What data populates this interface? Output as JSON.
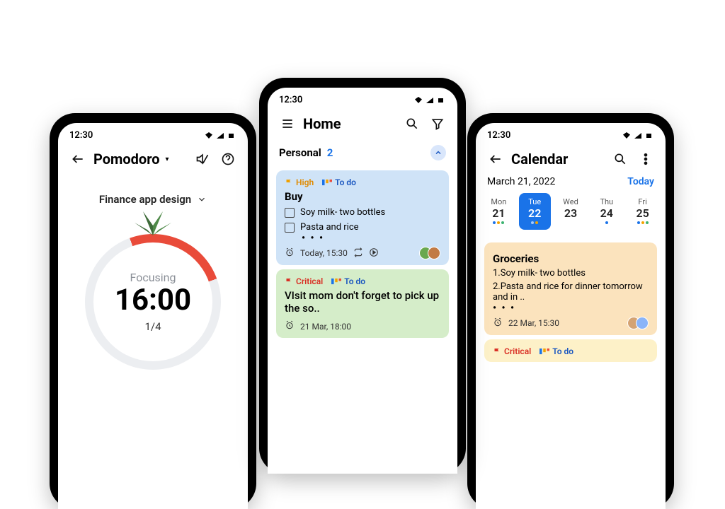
{
  "statusbar": {
    "time": "12:30"
  },
  "pomodoro": {
    "title": "Pomodoro",
    "task": "Finance app design",
    "status": "Focusing",
    "time": "16:00",
    "cycle": "1/4"
  },
  "home": {
    "title": "Home",
    "section": {
      "name": "Personal",
      "count": "2"
    },
    "card1": {
      "priority": "High",
      "kanban": "To do",
      "title": "Buy",
      "item1": "Soy milk- two bottles",
      "item2": "Pasta and rice",
      "more": "• • •",
      "due": "Today, 15:30"
    },
    "card2": {
      "priority": "Critical",
      "kanban": "To do",
      "title": "VIsit mom don't forget to pick up the so..",
      "due": "21 Mar, 18:00"
    }
  },
  "calendar": {
    "title": "Calendar",
    "date": "March 21, 2022",
    "today": "Today",
    "days": {
      "mon": {
        "dow": "Mon",
        "num": "21"
      },
      "tue": {
        "dow": "Tue",
        "num": "22"
      },
      "wed": {
        "dow": "Wed",
        "num": "23"
      },
      "thu": {
        "dow": "Thu",
        "num": "24"
      },
      "fri": {
        "dow": "Fri",
        "num": "25"
      }
    },
    "card1": {
      "title": "Groceries",
      "line1": "1.Soy milk- two bottles",
      "line2": "2.Pasta and rice for dinner tomorrow and in ..",
      "more": "• • •",
      "due": "22 Mar, 15:30"
    },
    "card2": {
      "priority": "Critical",
      "kanban": "To do"
    }
  }
}
